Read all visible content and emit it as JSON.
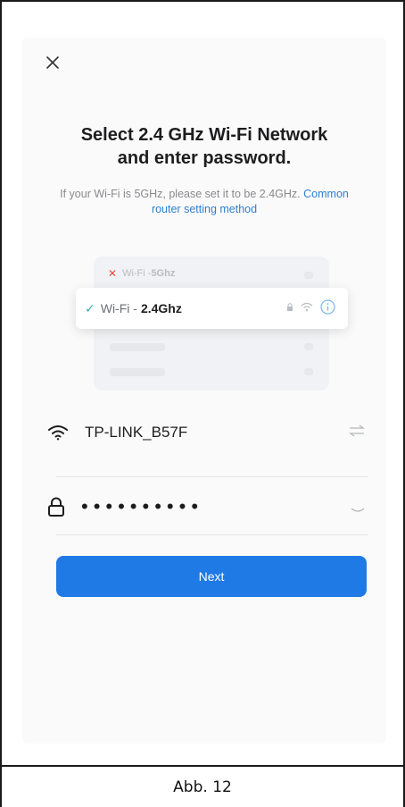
{
  "screen": {
    "title_line1": "Select 2.4 GHz Wi-Fi Network",
    "title_line2": "and enter password.",
    "subtitle_text": "If your Wi-Fi is 5GHz, please set it to be 2.4GHz.",
    "subtitle_link": "Common router setting method"
  },
  "illustration": {
    "network_5g_prefix": "Wi-Fi - ",
    "network_5g_band": "5Ghz",
    "network_24g_prefix": "Wi-Fi -",
    "network_24g_band": "2.4Ghz"
  },
  "form": {
    "ssid_value": "TP-LINK_B57F",
    "password_masked": "••••••••••",
    "next_label": "Next"
  },
  "caption": "Abb. 12",
  "icons": {
    "close": "close-icon",
    "wifi": "wifi-icon",
    "swap": "swap-icon",
    "lock": "lock-icon",
    "eye_closed": "eye-closed-icon"
  },
  "colors": {
    "accent_blue": "#1f7ae6",
    "link_blue": "#2f80d1",
    "check_green": "#39b0a5",
    "error_red": "#e5483f"
  }
}
